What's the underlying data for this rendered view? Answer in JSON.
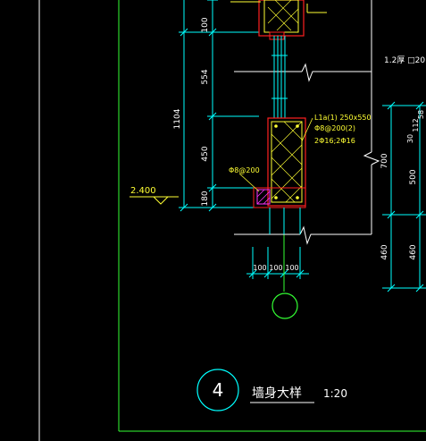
{
  "colors": {
    "background": "#000000",
    "frame": "#33ff33",
    "dimension": "#00ffff",
    "wall_line": "#ffffff",
    "rebar": "#ffff33",
    "concrete": "#ff2020",
    "hatch": "#ff33ff"
  },
  "dimensions": {
    "left_outer": "1104",
    "left_segments": [
      "100",
      "554",
      "450",
      "180"
    ],
    "right_outer": "700",
    "right_segments": [
      "500",
      "460"
    ],
    "right_small": [
      "30",
      "112",
      "58"
    ],
    "bottom": [
      "100",
      "100",
      "100"
    ]
  },
  "annotations": {
    "level": "2.400",
    "beam_label": "L1a(1) 250x550",
    "beam_stirrup": "Φ8@200(2)",
    "beam_bars": "2Φ16;2Φ16",
    "tie": "Φ8@200",
    "wall_note": "1.2厚 □20"
  },
  "title": {
    "number": "4",
    "name": "墙身大样",
    "scale": "1:20"
  }
}
